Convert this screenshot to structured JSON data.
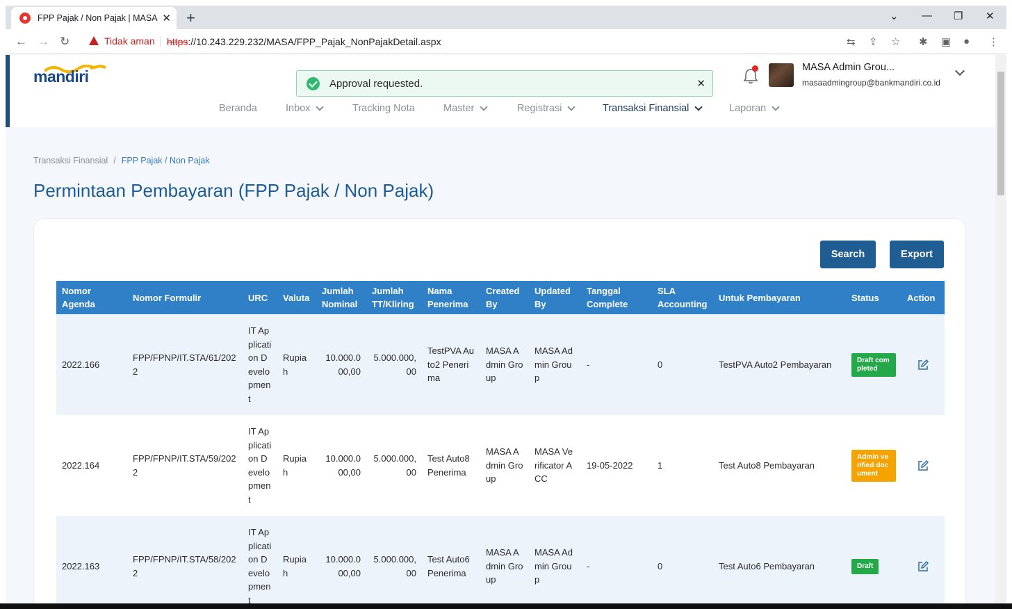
{
  "browser": {
    "tab_title": "FPP Pajak / Non Pajak | MASA",
    "security_label": "Tidak aman",
    "url_scheme": "https",
    "url_rest": "://10.243.229.232/MASA/FPP_Pajak_NonPajakDetail.aspx"
  },
  "header": {
    "logo_text": "mandiri",
    "toast": "Approval requested.",
    "user_name": "MASA Admin Grou...",
    "user_email": "masaadmingroup@bankmandiri.co.id"
  },
  "menu": [
    "Beranda",
    "Inbox",
    "Tracking Nota",
    "Master",
    "Registrasi",
    "Transaksi Finansial",
    "Laporan"
  ],
  "breadcrumb": {
    "parent": "Transaksi Finansial",
    "separator": "/",
    "current": "FPP Pajak / Non Pajak"
  },
  "page_title": "Permintaan Pembayaran (FPP Pajak / Non Pajak)",
  "buttons": {
    "search": "Search",
    "export": "Export"
  },
  "table": {
    "headers": [
      "Nomor Agenda",
      "Nomor Formulir",
      "URC",
      "Valuta",
      "Jumlah Nominal",
      "Jumlah TT/Kliring",
      "Nama Penerima",
      "Created By",
      "Updated By",
      "Tanggal Complete",
      "SLA Accounting",
      "Untuk Pembayaran",
      "Status",
      "Action"
    ],
    "rows": [
      {
        "agenda": "2022.166",
        "formulir": "FPP/FPNP/IT.STA/61/2022",
        "urc": "IT Application Development",
        "valuta": "Rupiah",
        "nominal": "10.000.000,00",
        "kliring": "5.000.000,00",
        "penerima": "TestPVA Auto2 Penerima",
        "created": "MASA Admin Group",
        "updated": "MASA Admin Group",
        "tanggal": "-",
        "sla": "0",
        "untuk": "TestPVA Auto2 Pembayaran",
        "status": "Draft completed",
        "status_color": "#23a94a"
      },
      {
        "agenda": "2022.164",
        "formulir": "FPP/FPNP/IT.STA/59/2022",
        "urc": "IT Application Development",
        "valuta": "Rupiah",
        "nominal": "10.000.000,00",
        "kliring": "5.000.000,00",
        "penerima": "Test Auto8 Penerima",
        "created": "MASA Admin Group",
        "updated": "MASA Verificator ACC",
        "tanggal": "19-05-2022",
        "sla": "1",
        "untuk": "Test Auto8 Pembayaran",
        "status": "Admin verified document",
        "status_color": "#f5a300"
      },
      {
        "agenda": "2022.163",
        "formulir": "FPP/FPNP/IT.STA/58/2022",
        "urc": "IT Application Development",
        "valuta": "Rupiah",
        "nominal": "10.000.000,00",
        "kliring": "5.000.000,00",
        "penerima": "Test Auto6 Penerima",
        "created": "MASA Admin Group",
        "updated": "MASA Admin Group",
        "tanggal": "-",
        "sla": "0",
        "untuk": "Test Auto6 Pembayaran",
        "status": "Draft",
        "status_color": "#23a94a"
      }
    ]
  }
}
